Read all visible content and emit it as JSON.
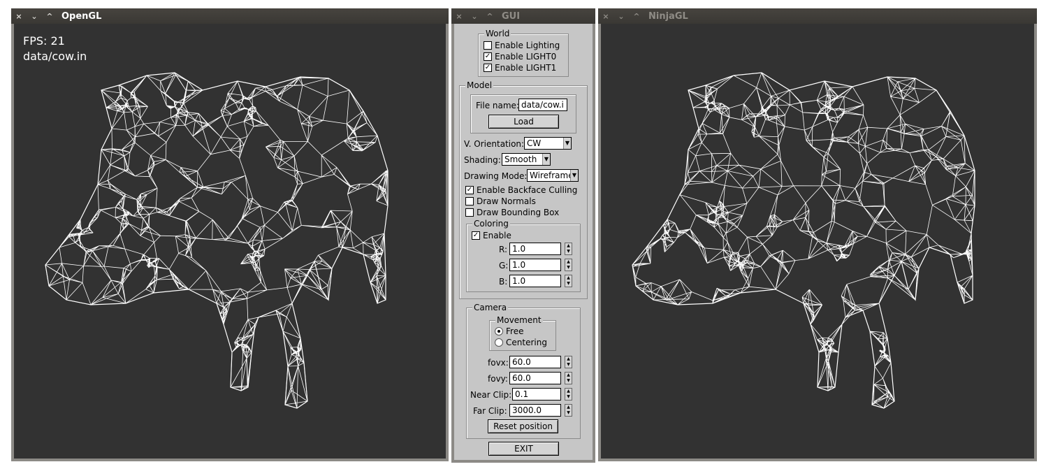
{
  "windows": {
    "opengl": {
      "title": "OpenGL",
      "close_glyph": "×",
      "minimize_glyph": "⌄",
      "maximize_glyph": "^",
      "fps_text": "FPS: 21",
      "file_text": "data/cow.in"
    },
    "gui": {
      "title": "GUI",
      "close_glyph": "×",
      "minimize_glyph": "⌄",
      "maximize_glyph": "^"
    },
    "ninjagl": {
      "title": "NinjaGL",
      "close_glyph": "×",
      "minimize_glyph": "⌄",
      "maximize_glyph": "^"
    }
  },
  "gui": {
    "world": {
      "legend": "World",
      "enable_lighting": {
        "label": "Enable Lighting",
        "checked": false
      },
      "enable_light0": {
        "label": "Enable LIGHT0",
        "checked": true
      },
      "enable_light1": {
        "label": "Enable LIGHT1",
        "checked": true
      }
    },
    "model": {
      "legend": "Model",
      "file_name_label": "File name:",
      "file_name_value": "data/cow.i",
      "load_label": "Load",
      "orientation_label": "V. Orientation:",
      "orientation_value": "CW",
      "shading_label": "Shading:",
      "shading_value": "Smooth",
      "drawing_mode_label": "Drawing Mode:",
      "drawing_mode_value": "Wireframe",
      "backface_culling": {
        "label": "Enable Backface Culling",
        "checked": true
      },
      "draw_normals": {
        "label": "Draw Normals",
        "checked": false
      },
      "draw_bbox": {
        "label": "Draw Bounding Box",
        "checked": false
      },
      "coloring": {
        "legend": "Coloring",
        "enable": {
          "label": "Enable",
          "checked": true
        },
        "r_label": "R:",
        "r_value": "1.0",
        "g_label": "G:",
        "g_value": "1.0",
        "b_label": "B:",
        "b_value": "1.0"
      }
    },
    "camera": {
      "legend": "Camera",
      "movement_legend": "Movement",
      "free_label": "Free",
      "centering_label": "Centering",
      "selected_movement": "Free",
      "fovx_label": "fovx:",
      "fovx_value": "60.0",
      "fovy_label": "fovy:",
      "fovy_value": "60.0",
      "near_label": "Near Clip:",
      "near_value": "0.1",
      "far_label": "Far Clip:",
      "far_value": "3000.0",
      "reset_label": "Reset position"
    },
    "exit_label": "EXIT"
  },
  "check_glyph": "✓",
  "spin_up_glyph": "▲",
  "spin_down_glyph": "▼",
  "dropdown_glyph": "▼",
  "colors": {
    "desktop": "#ffffff",
    "canvas": "#323232",
    "titlebar": "#3f3d39",
    "gui_panel": "#c6c6c6",
    "wireframe": "#ffffff"
  }
}
